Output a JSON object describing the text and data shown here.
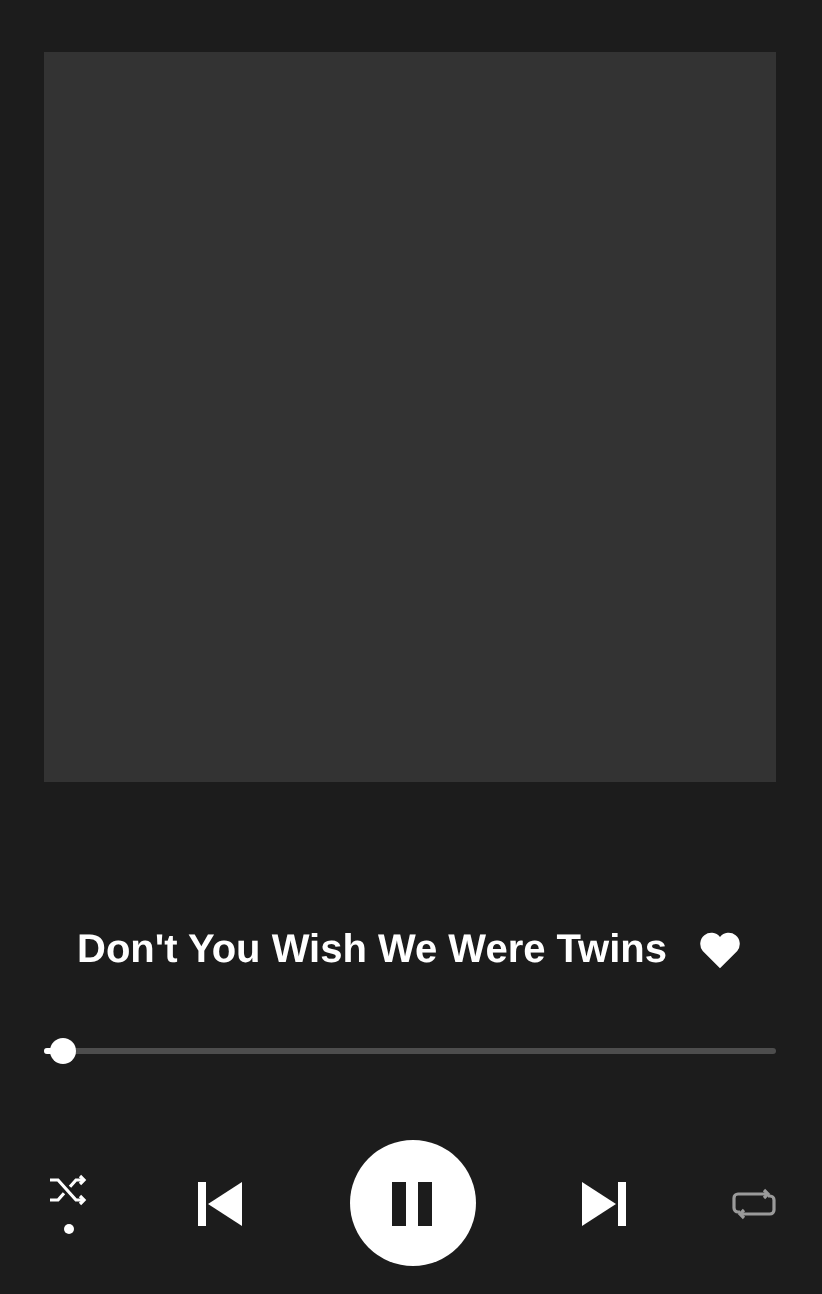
{
  "track": {
    "title": "Don't You Wish We Were Twins",
    "liked": true
  },
  "progress": {
    "level": 0.02
  },
  "controls": {
    "shuffle": true,
    "playing": true,
    "repeat": false
  }
}
